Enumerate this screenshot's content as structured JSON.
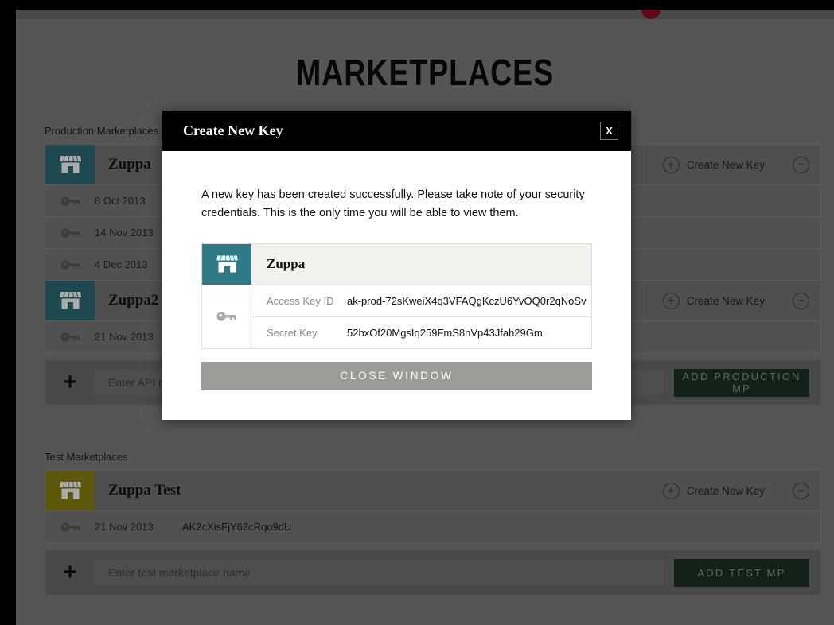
{
  "page": {
    "title": "MARKETPLACES",
    "accent_teal": "#2f6d78",
    "accent_olive": "#8a8210",
    "accent_green": "#1d3225",
    "notification_dot_color": "#8c1020"
  },
  "production": {
    "label": "Production Marketplaces",
    "marketplaces": [
      {
        "name": "Zuppa",
        "icon": "storefront-icon",
        "create_key_label": "Create New Key",
        "keys": [
          {
            "date": "8 Oct 2013",
            "value": ""
          },
          {
            "date": "14 Nov 2013",
            "value": ""
          },
          {
            "date": "4 Dec 2013",
            "value": ""
          }
        ]
      },
      {
        "name": "Zuppa2",
        "icon": "storefront-icon",
        "create_key_label": "Create New Key",
        "keys": [
          {
            "date": "21 Nov 2013",
            "value": ""
          }
        ]
      }
    ],
    "add_placeholder": "Enter API marketplace name",
    "add_button": "ADD PRODUCTION MP"
  },
  "test": {
    "label": "Test Marketplaces",
    "marketplaces": [
      {
        "name": "Zuppa Test",
        "icon": "storefront-icon",
        "create_key_label": "Create New Key",
        "keys": [
          {
            "date": "21 Nov 2013",
            "value": "AK2cXisFjY62cRqo9dU"
          }
        ]
      }
    ],
    "add_placeholder": "Enter test marketplace name",
    "add_button": "ADD TEST MP"
  },
  "modal": {
    "title": "Create New Key",
    "close_label": "X",
    "message": "A new key has been created successfully. Please take note of your security credentials. This is the only time you will be able to view them.",
    "marketplace_name": "Zuppa",
    "credentials": [
      {
        "label": "Access Key ID",
        "value": "ak-prod-72sKweiX4q3VFAQgKczU6YvOQ0r2qNoSv"
      },
      {
        "label": "Secret Key",
        "value": "52hxOf20MgsIq259FmS8nVp43Jfah29Gm"
      }
    ],
    "close_button": "CLOSE WINDOW"
  },
  "icons": {
    "create": "plus-circle-icon",
    "remove": "minus-circle-icon",
    "add": "plus-icon",
    "key": "key-icon",
    "shop": "storefront-icon"
  },
  "glyphs": {
    "plus": "+",
    "minus": "−",
    "add": "+"
  }
}
